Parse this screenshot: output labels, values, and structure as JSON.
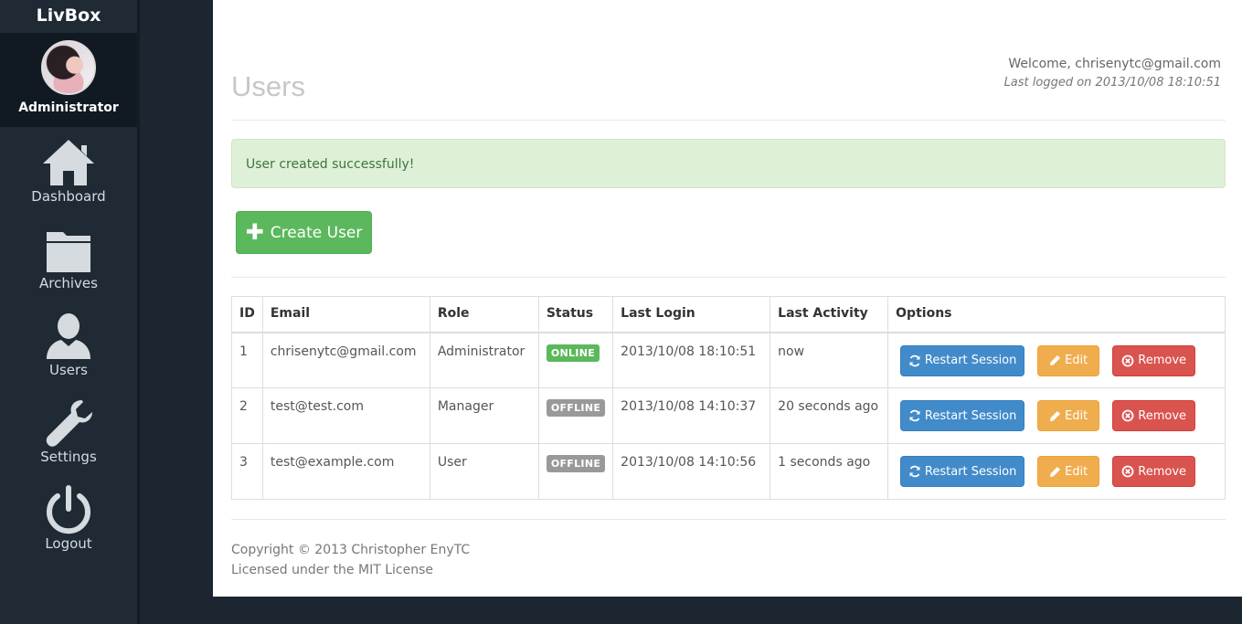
{
  "sidebar": {
    "brand": "LivBox",
    "profile_name": "Administrator",
    "items": [
      {
        "label": "Dashboard",
        "icon": "home-icon"
      },
      {
        "label": "Archives",
        "icon": "folder-icon"
      },
      {
        "label": "Users",
        "icon": "user-icon"
      },
      {
        "label": "Settings",
        "icon": "wrench-icon"
      },
      {
        "label": "Logout",
        "icon": "power-icon"
      }
    ]
  },
  "header": {
    "title": "Users",
    "welcome": "Welcome, chrisenytc@gmail.com",
    "last_logged": "Last logged on 2013/10/08 18:10:51"
  },
  "alert": {
    "message": "User created successfully!"
  },
  "create_button": {
    "label": "Create User",
    "icon": "plus-icon"
  },
  "table": {
    "columns": [
      "ID",
      "Email",
      "Role",
      "Status",
      "Last Login",
      "Last Activity",
      "Options"
    ],
    "rows": [
      {
        "id": "1",
        "email": "chrisenytc@gmail.com",
        "role": "Administrator",
        "status": "ONLINE",
        "last_login": "2013/10/08 18:10:51",
        "last_activity": "now"
      },
      {
        "id": "2",
        "email": "test@test.com",
        "role": "Manager",
        "status": "OFFLINE",
        "last_login": "2013/10/08 14:10:37",
        "last_activity": "20 seconds ago"
      },
      {
        "id": "3",
        "email": "test@example.com",
        "role": "User",
        "status": "OFFLINE",
        "last_login": "2013/10/08 14:10:56",
        "last_activity": "1 seconds ago"
      }
    ],
    "actions": {
      "restart": "Restart Session",
      "edit": "Edit",
      "remove": "Remove"
    }
  },
  "footer": {
    "copyright": "Copyright © 2013 Christopher EnyTC",
    "license": "Licensed under the MIT License"
  },
  "colors": {
    "sidebar_bg": "#1f2a34",
    "online": "#5cb85c",
    "offline": "#999999",
    "restart": "#428bca",
    "edit": "#f0ad4e",
    "remove": "#d9534f",
    "success": "#5cb85c"
  }
}
